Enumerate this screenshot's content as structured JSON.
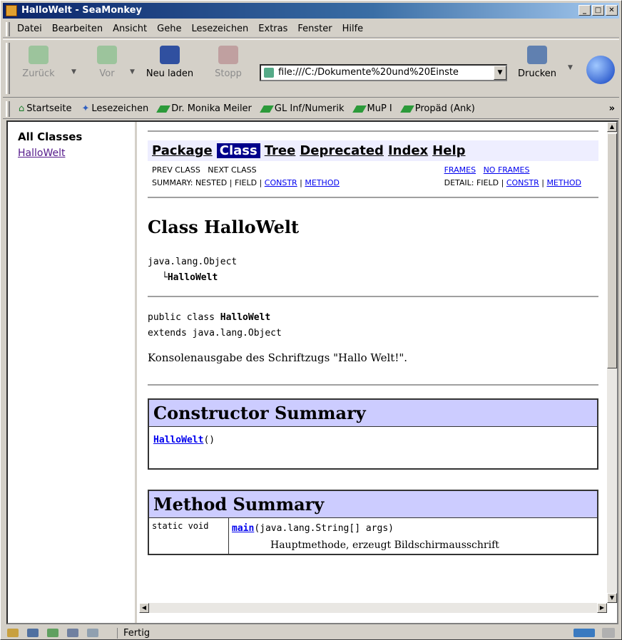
{
  "window": {
    "title": "HalloWelt - SeaMonkey"
  },
  "menu": [
    "Datei",
    "Bearbeiten",
    "Ansicht",
    "Gehe",
    "Lesezeichen",
    "Extras",
    "Fenster",
    "Hilfe"
  ],
  "nav": {
    "back": "Zurück",
    "forward": "Vor",
    "reload": "Neu laden",
    "stop": "Stopp",
    "print": "Drucken",
    "url": "file:///C:/Dokumente%20und%20Einste"
  },
  "bookmarks": [
    "Startseite",
    "Lesezeichen",
    "Dr. Monika Meiler",
    "GL Inf/Numerik",
    "MuP I",
    "Propäd (Ank)"
  ],
  "left": {
    "heading": "All Classes",
    "link": "HalloWelt"
  },
  "doc": {
    "navbar": {
      "package": "Package",
      "class": "Class",
      "tree": "Tree",
      "deprecated": "Deprecated",
      "index": "Index",
      "help": "Help"
    },
    "subnav": {
      "prev_next": "PREV CLASS   NEXT CLASS",
      "frames": "FRAMES",
      "noframes": "NO FRAMES",
      "summary_prefix": "SUMMARY: NESTED | FIELD | ",
      "constr": "CONSTR",
      "sep": " | ",
      "method": "METHOD",
      "detail_prefix": "DETAIL: FIELD | "
    },
    "title": "Class HalloWelt",
    "hier_parent": "java.lang.Object",
    "hier_child": "HalloWelt",
    "decl_prefix": "public class ",
    "decl_name": "HalloWelt",
    "decl_extends": "extends java.lang.Object",
    "description": "Konsolenausgabe des Schriftzugs \"Hallo Welt!\".",
    "constructor_summary": "Constructor Summary",
    "constructor_name": "HalloWelt",
    "constructor_args": "()",
    "method_summary": "Method Summary",
    "method_mod": "static void",
    "method_name": "main",
    "method_args": "(java.lang.String[] args)",
    "method_desc": "Hauptmethode, erzeugt Bildschirmausschrift"
  },
  "status": {
    "text": "Fertig"
  }
}
